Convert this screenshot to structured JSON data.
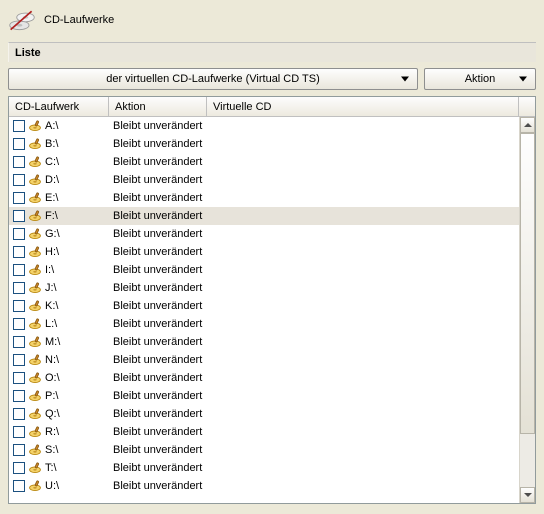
{
  "header": {
    "title": "CD-Laufwerke"
  },
  "section_label": "Liste",
  "filter_dropdown": {
    "label": "der virtuellen CD-Laufwerke (Virtual CD TS)"
  },
  "action_dropdown": {
    "label": "Aktion"
  },
  "columns": {
    "drive": "CD-Laufwerk",
    "action": "Aktion",
    "virtual": "Virtuelle CD"
  },
  "default_action": "Bleibt unverändert",
  "selected_index": 5,
  "rows": [
    {
      "drive": "A:\\",
      "action": "Bleibt unverändert",
      "virtual": ""
    },
    {
      "drive": "B:\\",
      "action": "Bleibt unverändert",
      "virtual": ""
    },
    {
      "drive": "C:\\",
      "action": "Bleibt unverändert",
      "virtual": ""
    },
    {
      "drive": "D:\\",
      "action": "Bleibt unverändert",
      "virtual": ""
    },
    {
      "drive": "E:\\",
      "action": "Bleibt unverändert",
      "virtual": ""
    },
    {
      "drive": "F:\\",
      "action": "Bleibt unverändert",
      "virtual": ""
    },
    {
      "drive": "G:\\",
      "action": "Bleibt unverändert",
      "virtual": ""
    },
    {
      "drive": "H:\\",
      "action": "Bleibt unverändert",
      "virtual": ""
    },
    {
      "drive": "I:\\",
      "action": "Bleibt unverändert",
      "virtual": ""
    },
    {
      "drive": "J:\\",
      "action": "Bleibt unverändert",
      "virtual": ""
    },
    {
      "drive": "K:\\",
      "action": "Bleibt unverändert",
      "virtual": ""
    },
    {
      "drive": "L:\\",
      "action": "Bleibt unverändert",
      "virtual": ""
    },
    {
      "drive": "M:\\",
      "action": "Bleibt unverändert",
      "virtual": ""
    },
    {
      "drive": "N:\\",
      "action": "Bleibt unverändert",
      "virtual": ""
    },
    {
      "drive": "O:\\",
      "action": "Bleibt unverändert",
      "virtual": ""
    },
    {
      "drive": "P:\\",
      "action": "Bleibt unverändert",
      "virtual": ""
    },
    {
      "drive": "Q:\\",
      "action": "Bleibt unverändert",
      "virtual": ""
    },
    {
      "drive": "R:\\",
      "action": "Bleibt unverändert",
      "virtual": ""
    },
    {
      "drive": "S:\\",
      "action": "Bleibt unverändert",
      "virtual": ""
    },
    {
      "drive": "T:\\",
      "action": "Bleibt unverändert",
      "virtual": ""
    },
    {
      "drive": "U:\\",
      "action": "Bleibt unverändert",
      "virtual": ""
    }
  ]
}
